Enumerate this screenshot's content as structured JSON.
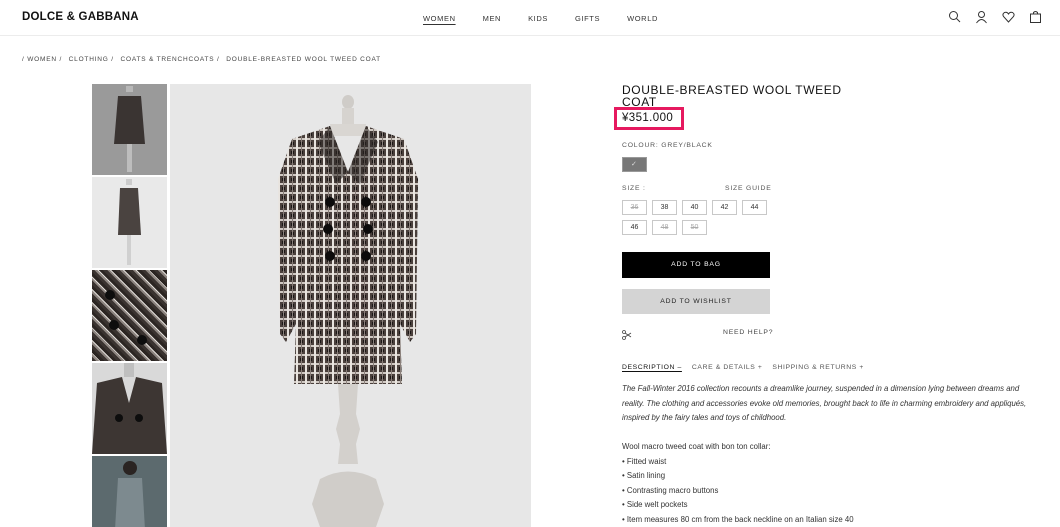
{
  "header": {
    "logo": "DOLCE & GABBANA",
    "nav": [
      "WOMEN",
      "MEN",
      "KIDS",
      "GIFTS",
      "WORLD"
    ],
    "icons": [
      "search-icon",
      "account-icon",
      "wishlist-heart-icon",
      "shopping-bag-icon"
    ]
  },
  "breadcrumb": [
    "/ WOMEN /",
    "CLOTHING /",
    "COATS & TRENCHCOATS /",
    "DOUBLE-BREASTED WOOL TWEED COAT"
  ],
  "product": {
    "title": "DOUBLE-BREASTED WOOL TWEED COAT",
    "price": "¥351.000",
    "colour_label": "COLOUR: GREY/BLACK",
    "swatch_check": "✓",
    "size_label": "SIZE :",
    "size_guide": "SIZE GUIDE",
    "sizes": [
      {
        "label": "36",
        "available": false
      },
      {
        "label": "38",
        "available": true
      },
      {
        "label": "40",
        "available": true
      },
      {
        "label": "42",
        "available": true
      },
      {
        "label": "44",
        "available": true
      },
      {
        "label": "46",
        "available": true
      },
      {
        "label": "48",
        "available": false
      },
      {
        "label": "50",
        "available": false
      }
    ],
    "add_to_bag": "ADD TO BAG",
    "add_to_wishlist": "ADD TO WISHLIST",
    "need_help": "NEED HELP?"
  },
  "tabs": [
    "DESCRIPTION –",
    "CARE & DETAILS +",
    "SHIPPING & RETURNS +"
  ],
  "description": {
    "paragraph": "The Fall-Winter 2016 collection recounts a dreamlike journey, suspended in a dimension lying between dreams and reality. The clothing and accessories evoke old memories, brought back to life in charming embroidery and appliqués, inspired by the fairy tales and toys of childhood.",
    "intro": "Wool macro tweed coat with bon ton collar:",
    "bullets": [
      "• Fitted waist",
      "• Satin lining",
      "• Contrasting macro buttons",
      "• Side welt pockets",
      "• Item measures 80 cm from the back neckline on an Italian size 40"
    ]
  },
  "colors": {
    "highlight": "#e6195f",
    "bag_button": "#000000",
    "wishlist_button": "#d4d4d4"
  }
}
